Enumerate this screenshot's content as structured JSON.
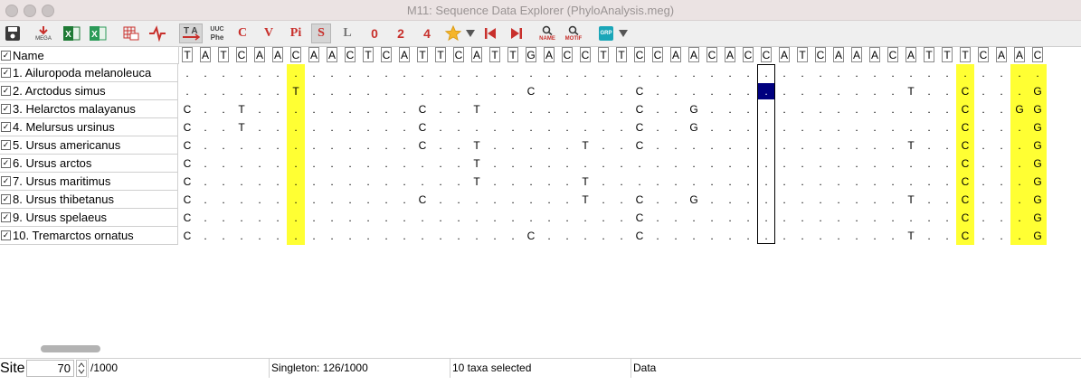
{
  "window": {
    "title": "M11: Sequence Data Explorer (PhyloAnalysis.meg)"
  },
  "toolbar": {
    "save_icon": "save-icon",
    "mega_label": "MEGA",
    "uuc_label": "UUC",
    "phe_label": "Phe",
    "c_label": "C",
    "v_label": "V",
    "pi_label": "Pi",
    "s_label": "S",
    "l_label": "L",
    "zero_label": "0",
    "two_label": "2",
    "four_label": "4",
    "name_label": "NAME",
    "motif_label": "MOTIF",
    "grp_label": "GRP",
    "colors": {
      "red": "#c8302c",
      "green": "#1e7a35",
      "blue_grp": "#1aa6b8"
    }
  },
  "header": {
    "name_label": "Name",
    "sequence": [
      "T",
      "A",
      "T",
      "C",
      "A",
      "A",
      "C",
      "A",
      "A",
      "C",
      "T",
      "C",
      "A",
      "T",
      "T",
      "C",
      "A",
      "T",
      "T",
      "G",
      "A",
      "C",
      "C",
      "T",
      "T",
      "C",
      "C",
      "A",
      "A",
      "C",
      "A",
      "C",
      "C",
      "A",
      "T",
      "C",
      "A",
      "A",
      "A",
      "C",
      "A",
      "T",
      "T",
      "T",
      "C",
      "A",
      "A",
      "C"
    ]
  },
  "taxa": [
    {
      "name": "1. Ailuropoda melanoleuca",
      "checked": true,
      "seq": [
        ".",
        ".",
        ".",
        ".",
        ".",
        ".",
        ".",
        ".",
        ".",
        ".",
        ".",
        ".",
        ".",
        ".",
        ".",
        ".",
        ".",
        ".",
        ".",
        ".",
        ".",
        ".",
        ".",
        ".",
        ".",
        ".",
        ".",
        ".",
        ".",
        ".",
        ".",
        ".",
        ".",
        ".",
        ".",
        ".",
        ".",
        ".",
        ".",
        ".",
        ".",
        ".",
        ".",
        ".",
        ".",
        ".",
        ".",
        "."
      ]
    },
    {
      "name": "2. Arctodus simus",
      "checked": true,
      "seq": [
        ".",
        ".",
        ".",
        ".",
        ".",
        ".",
        "T",
        ".",
        ".",
        ".",
        ".",
        ".",
        ".",
        ".",
        ".",
        ".",
        ".",
        ".",
        ".",
        "C",
        ".",
        ".",
        ".",
        ".",
        ".",
        "C",
        ".",
        ".",
        ".",
        ".",
        ".",
        ".",
        ".",
        ".",
        ".",
        ".",
        ".",
        ".",
        ".",
        ".",
        "T",
        ".",
        ".",
        "C",
        ".",
        ".",
        ".",
        "G"
      ]
    },
    {
      "name": "3. Helarctos malayanus",
      "checked": true,
      "seq": [
        "C",
        ".",
        ".",
        "T",
        ".",
        ".",
        ".",
        ".",
        ".",
        ".",
        ".",
        ".",
        ".",
        "C",
        ".",
        ".",
        "T",
        ".",
        ".",
        ".",
        ".",
        ".",
        ".",
        ".",
        ".",
        "C",
        ".",
        ".",
        "G",
        ".",
        ".",
        ".",
        ".",
        ".",
        ".",
        ".",
        ".",
        ".",
        ".",
        ".",
        ".",
        ".",
        ".",
        "C",
        ".",
        ".",
        "G",
        "G"
      ]
    },
    {
      "name": "4. Melursus ursinus",
      "checked": true,
      "seq": [
        "C",
        ".",
        ".",
        "T",
        ".",
        ".",
        ".",
        ".",
        ".",
        ".",
        ".",
        ".",
        ".",
        "C",
        ".",
        ".",
        ".",
        ".",
        ".",
        ".",
        ".",
        ".",
        ".",
        ".",
        ".",
        "C",
        ".",
        ".",
        "G",
        ".",
        ".",
        ".",
        ".",
        ".",
        ".",
        ".",
        ".",
        ".",
        ".",
        ".",
        ".",
        ".",
        ".",
        "C",
        ".",
        ".",
        ".",
        "G"
      ]
    },
    {
      "name": "5. Ursus americanus",
      "checked": true,
      "seq": [
        "C",
        ".",
        ".",
        ".",
        ".",
        ".",
        ".",
        ".",
        ".",
        ".",
        ".",
        ".",
        ".",
        "C",
        ".",
        ".",
        "T",
        ".",
        ".",
        ".",
        ".",
        ".",
        "T",
        ".",
        ".",
        "C",
        ".",
        ".",
        ".",
        ".",
        ".",
        ".",
        ".",
        ".",
        ".",
        ".",
        ".",
        ".",
        ".",
        ".",
        "T",
        ".",
        ".",
        "C",
        ".",
        ".",
        ".",
        "G"
      ]
    },
    {
      "name": "6. Ursus arctos",
      "checked": true,
      "seq": [
        "C",
        ".",
        ".",
        ".",
        ".",
        ".",
        ".",
        ".",
        ".",
        ".",
        ".",
        ".",
        ".",
        ".",
        ".",
        ".",
        "T",
        ".",
        ".",
        ".",
        ".",
        ".",
        ".",
        ".",
        ".",
        ".",
        ".",
        ".",
        ".",
        ".",
        ".",
        ".",
        ".",
        ".",
        ".",
        ".",
        ".",
        ".",
        ".",
        ".",
        ".",
        ".",
        ".",
        "C",
        ".",
        ".",
        ".",
        "G"
      ]
    },
    {
      "name": "7. Ursus maritimus",
      "checked": true,
      "seq": [
        "C",
        ".",
        ".",
        ".",
        ".",
        ".",
        ".",
        ".",
        ".",
        ".",
        ".",
        ".",
        ".",
        ".",
        ".",
        ".",
        "T",
        ".",
        ".",
        ".",
        ".",
        ".",
        "T",
        ".",
        ".",
        ".",
        ".",
        ".",
        ".",
        ".",
        ".",
        ".",
        ".",
        ".",
        ".",
        ".",
        ".",
        ".",
        ".",
        ".",
        ".",
        ".",
        ".",
        "C",
        ".",
        ".",
        ".",
        "G"
      ]
    },
    {
      "name": "8. Ursus thibetanus",
      "checked": true,
      "seq": [
        "C",
        ".",
        ".",
        ".",
        ".",
        ".",
        ".",
        ".",
        ".",
        ".",
        ".",
        ".",
        ".",
        "C",
        ".",
        ".",
        ".",
        ".",
        ".",
        ".",
        ".",
        ".",
        "T",
        ".",
        ".",
        "C",
        ".",
        ".",
        "G",
        ".",
        ".",
        ".",
        ".",
        ".",
        ".",
        ".",
        ".",
        ".",
        ".",
        ".",
        "T",
        ".",
        ".",
        "C",
        ".",
        ".",
        ".",
        "G"
      ]
    },
    {
      "name": "9. Ursus spelaeus",
      "checked": true,
      "seq": [
        "C",
        ".",
        ".",
        ".",
        ".",
        ".",
        ".",
        ".",
        ".",
        ".",
        ".",
        ".",
        ".",
        ".",
        ".",
        ".",
        ".",
        ".",
        ".",
        ".",
        ".",
        ".",
        ".",
        ".",
        ".",
        "C",
        ".",
        ".",
        ".",
        ".",
        ".",
        ".",
        ".",
        ".",
        ".",
        ".",
        ".",
        ".",
        ".",
        ".",
        ".",
        ".",
        ".",
        "C",
        ".",
        ".",
        ".",
        "G"
      ]
    },
    {
      "name": "10. Tremarctos ornatus",
      "checked": true,
      "seq": [
        "C",
        ".",
        ".",
        ".",
        ".",
        ".",
        ".",
        ".",
        ".",
        ".",
        ".",
        ".",
        ".",
        ".",
        ".",
        ".",
        ".",
        ".",
        ".",
        "C",
        ".",
        ".",
        ".",
        ".",
        ".",
        "C",
        ".",
        ".",
        ".",
        ".",
        ".",
        ".",
        ".",
        ".",
        ".",
        ".",
        ".",
        ".",
        ".",
        ".",
        "T",
        ".",
        ".",
        "C",
        ".",
        ".",
        ".",
        "G"
      ]
    }
  ],
  "highlight_columns": [
    6,
    43,
    46,
    47
  ],
  "selected_column": 32,
  "selected_row": 1,
  "highlight_color": "#ffff33",
  "selection_color": "#00007f",
  "status": {
    "site_label": "Site",
    "site_value": "70",
    "total": "/1000",
    "singleton": "Singleton: 126/1000",
    "taxa_selected": "10 taxa selected",
    "data_label": "Data"
  }
}
